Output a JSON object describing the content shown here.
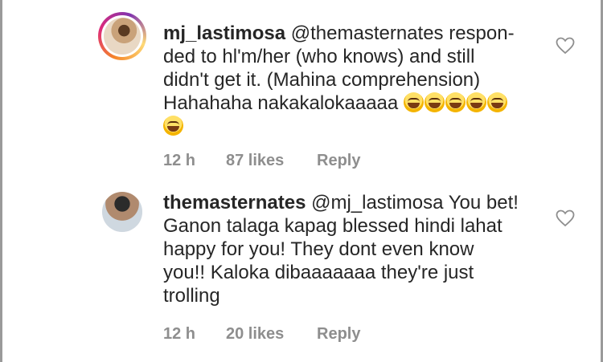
{
  "comments": [
    {
      "username": "mj_lastimosa",
      "mention": "@themasternates",
      "text_line1": " respon-",
      "text_line2": "ded to hl'm/her (who knows) and still",
      "text_line3": "didn't get it. (Mahina comprehension)",
      "text_line4": "Hahahaha nakakalokaaaaa",
      "emoji_icon": "laughing-emoji-icon",
      "emoji_count": 6,
      "time": "12 h",
      "likes": "87 likes",
      "reply": "Reply"
    },
    {
      "username": "themasternates",
      "mention": "@mj_lastimosa",
      "text_line1": " You bet!",
      "text_line2": "Ganon talaga kapag blessed hindi lahat",
      "text_line3": "happy for you! They dont even know",
      "text_line4": "you!! Kaloka dibaaaaaaa they're just",
      "text_line5": "trolling",
      "time": "12 h",
      "likes": "20 likes",
      "reply": "Reply"
    }
  ],
  "colors": {
    "text": "#262626",
    "meta": "#8e8e8e",
    "heart": "#8e8e8e"
  }
}
